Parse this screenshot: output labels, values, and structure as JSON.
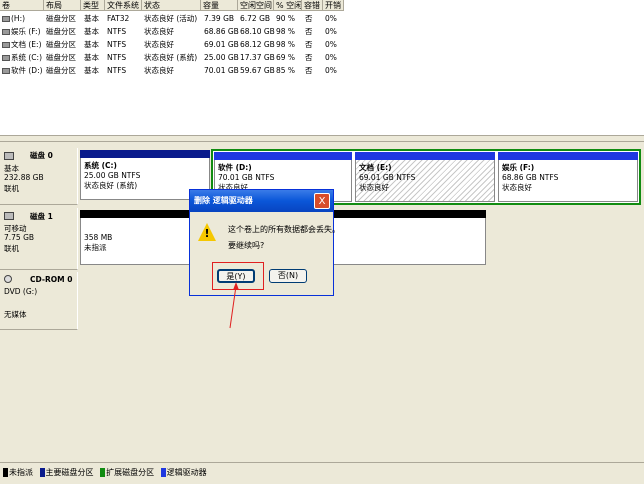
{
  "list": {
    "columns": [
      "卷",
      "布局",
      "类型",
      "文件系统",
      "状态",
      "容量",
      "空闲空间",
      "% 空闲",
      "容错",
      "开销"
    ],
    "rows": [
      [
        "(H:)",
        "磁盘分区",
        "基本",
        "FAT32",
        "状态良好 (活动)",
        "7.39 GB",
        "6.72 GB",
        "90 %",
        "否",
        "0%"
      ],
      [
        "娱乐 (F:)",
        "磁盘分区",
        "基本",
        "NTFS",
        "状态良好",
        "68.86 GB",
        "68.10 GB",
        "98 %",
        "否",
        "0%"
      ],
      [
        "文档 (E:)",
        "磁盘分区",
        "基本",
        "NTFS",
        "状态良好",
        "69.01 GB",
        "68.12 GB",
        "98 %",
        "否",
        "0%"
      ],
      [
        "系统 (C:)",
        "磁盘分区",
        "基本",
        "NTFS",
        "状态良好 (系统)",
        "25.00 GB",
        "17.37 GB",
        "69 %",
        "否",
        "0%"
      ],
      [
        "软件 (D:)",
        "磁盘分区",
        "基本",
        "NTFS",
        "状态良好",
        "70.01 GB",
        "59.67 GB",
        "85 %",
        "否",
        "0%"
      ]
    ]
  },
  "disks": [
    {
      "title": "磁盘 0",
      "type": "基本",
      "size": "232.88 GB",
      "status": "联机"
    },
    {
      "title": "磁盘 1",
      "type": "可移动",
      "size": "7.75 GB",
      "status": "联机"
    },
    {
      "title": "CD-ROM 0",
      "type": "DVD (G:)",
      "size": "",
      "status": "无媒体"
    }
  ],
  "partitions": {
    "c": {
      "name": "系统 (C:)",
      "size": "25.00 GB NTFS",
      "status": "状态良好 (系统)"
    },
    "d": {
      "name": "软件 (D:)",
      "size": "70.01 GB NTFS",
      "status": "状态良好"
    },
    "e": {
      "name": "文档 (E:)",
      "size": "69.01 GB NTFS",
      "status": "状态良好"
    },
    "f": {
      "name": "娱乐 (F:)",
      "size": "68.86 GB NTFS",
      "status": "状态良好"
    },
    "un": {
      "size": "358 MB",
      "status": "未指派"
    }
  },
  "legend": [
    "未指派",
    "主要磁盘分区",
    "扩展磁盘分区",
    "逻辑驱动器"
  ],
  "colors": {
    "unallocated": "#000000",
    "primary": "#0a1b8c",
    "extended": "#118c11",
    "logical": "#1f38e0",
    "dialog_title": "#0a56d8",
    "warn": "#f5c700",
    "annotation": "#e02020"
  },
  "dialog": {
    "title": "删除 逻辑驱动器",
    "close": "X",
    "icon": "warning-icon",
    "message": "这个卷上的所有数据都会丢失。",
    "question": "要继续吗?",
    "yes": "是(Y)",
    "no": "否(N)"
  }
}
